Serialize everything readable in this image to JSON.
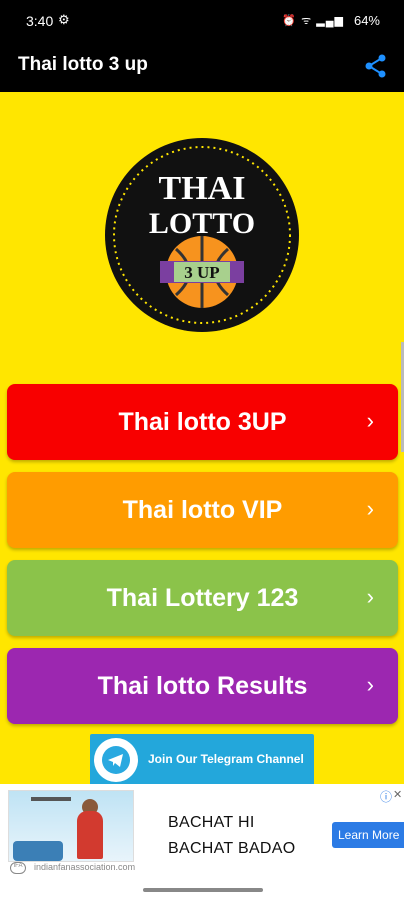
{
  "status_bar": {
    "time": "3:40",
    "battery": "64%",
    "icons": [
      "settings-icon",
      "alarm-icon",
      "wifi-icon",
      "signal-icon",
      "battery-icon"
    ]
  },
  "app_bar": {
    "title": "Thai lotto 3 up",
    "share_icon": "share-icon"
  },
  "logo": {
    "line1": "THAI",
    "line2": "LOTTO",
    "badge": "3 UP"
  },
  "menu": [
    {
      "label": "Thai lotto 3UP",
      "color": "#f80000"
    },
    {
      "label": "Thai lotto VIP",
      "color": "#ff9c00"
    },
    {
      "label": "Thai Lottery 123",
      "color": "#8bc34a"
    },
    {
      "label": "Thai lotto Results",
      "color": "#9c27b0"
    }
  ],
  "chevron": "›",
  "telegram": {
    "text": "Join Our Telegram Channel"
  },
  "ad": {
    "line1": "BACHAT HI",
    "line2": "BACHAT BADAO",
    "cta": "Learn More",
    "domain": "indianfanassociation.com"
  },
  "colors": {
    "background": "#ffe600",
    "bars": "#000000"
  }
}
